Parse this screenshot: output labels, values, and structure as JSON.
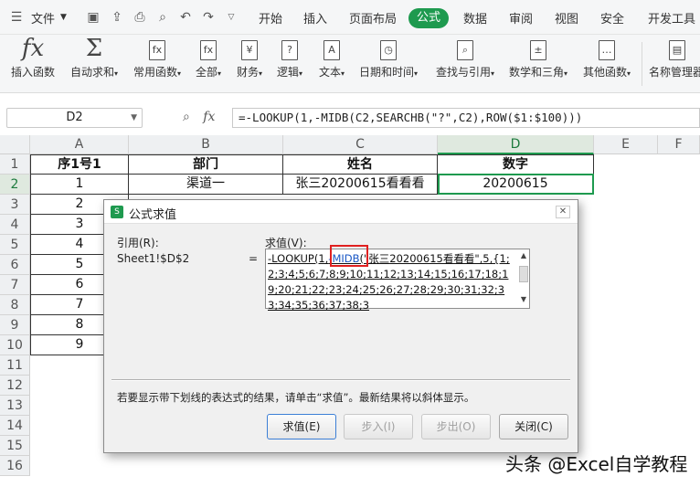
{
  "menubar": {
    "file_label": "文件",
    "tabs": [
      "开始",
      "插入",
      "页面布局",
      "公式",
      "数据",
      "审阅",
      "视图",
      "安全",
      "开发工具"
    ],
    "active_tab": "公式"
  },
  "ribbon": {
    "items": [
      {
        "label": "插入函数",
        "icon": "fx-icon"
      },
      {
        "label": "自动求和",
        "icon": "sum-icon"
      },
      {
        "label": "常用函数",
        "icon": "star-function-icon"
      },
      {
        "label": "全部",
        "icon": "all-functions-icon"
      },
      {
        "label": "财务",
        "icon": "yen-icon"
      },
      {
        "label": "逻辑",
        "icon": "question-icon"
      },
      {
        "label": "文本",
        "icon": "text-icon"
      },
      {
        "label": "日期和时间",
        "icon": "clock-icon"
      },
      {
        "label": "查找与引用",
        "icon": "search-icon"
      },
      {
        "label": "数学和三角",
        "icon": "math-icon"
      },
      {
        "label": "其他函数",
        "icon": "more-icon"
      },
      {
        "label": "名称管理器",
        "icon": "name-manager-icon"
      }
    ]
  },
  "formula_bar": {
    "name_box": "D2",
    "formula": "=-LOOKUP(1,-MIDB(C2,SEARCHB(\"?\",C2),ROW($1:$100)))"
  },
  "sheet": {
    "columns": [
      "A",
      "B",
      "C",
      "D",
      "E",
      "F"
    ],
    "rows": [
      "1",
      "2",
      "3",
      "4",
      "5",
      "6",
      "7",
      "8",
      "9",
      "10",
      "11",
      "12",
      "13",
      "14",
      "15",
      "16"
    ],
    "header": [
      "序1号1",
      "部门",
      "姓名",
      "数字"
    ],
    "row2": [
      "1",
      "渠道一",
      "张三20200615看看看",
      "20200615"
    ],
    "col_a": [
      "2",
      "3",
      "4",
      "5",
      "6",
      "7",
      "8",
      "9"
    ]
  },
  "dialog": {
    "title": "公式求值",
    "ref_label": "引用(R):",
    "ref_value": "Sheet1!$D$2",
    "eq": "=",
    "eval_label": "求值(V):",
    "eval_pre": "-LOOKUP(1,",
    "eval_hl": "-MIDB",
    "eval_post": "(\"张三20200615看看看\",5,{1;2;3;4;5;6;7;8;9;10;11;12;13;14;15;16;17;18;19;20;21;22;23;24;25;26;27;28;29;30;31;32;33;34;35;36;37;38;3",
    "hint": "若要显示带下划线的表达式的结果，请单击“求值”。最新结果将以斜体显示。",
    "buttons": {
      "evaluate": "求值(E)",
      "step_in": "步入(I)",
      "step_out": "步出(O)",
      "close": "关闭(C)"
    }
  },
  "watermark": "头条 @Excel自学教程"
}
